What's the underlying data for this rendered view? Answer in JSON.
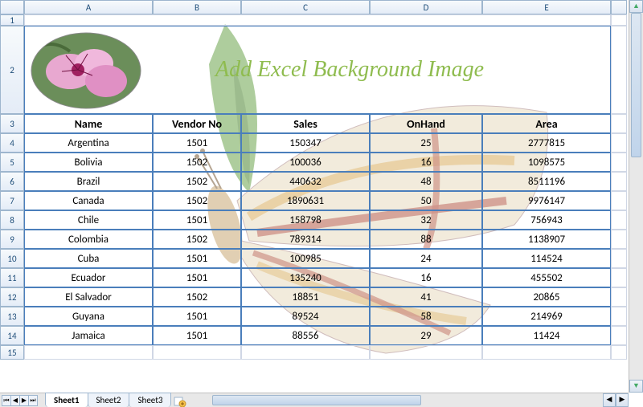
{
  "columns": [
    "A",
    "B",
    "C",
    "D",
    "E"
  ],
  "row_numbers": [
    1,
    2,
    3,
    4,
    5,
    6,
    7,
    8,
    9,
    10,
    11,
    12,
    13,
    14,
    15
  ],
  "title": "Add  Excel  Background  Image",
  "headers": [
    "Name",
    "Vendor No",
    "Sales",
    "OnHand",
    "Area"
  ],
  "rows": [
    {
      "name": "Argentina",
      "vendor": "1501",
      "sales": "150347",
      "onhand": "25",
      "area": "2777815"
    },
    {
      "name": "Bolivia",
      "vendor": "1502",
      "sales": "100036",
      "onhand": "16",
      "area": "1098575"
    },
    {
      "name": "Brazil",
      "vendor": "1502",
      "sales": "440632",
      "onhand": "48",
      "area": "8511196"
    },
    {
      "name": "Canada",
      "vendor": "1502",
      "sales": "1890631",
      "onhand": "50",
      "area": "9976147"
    },
    {
      "name": "Chile",
      "vendor": "1501",
      "sales": "158798",
      "onhand": "32",
      "area": "756943"
    },
    {
      "name": "Colombia",
      "vendor": "1502",
      "sales": "789314",
      "onhand": "88",
      "area": "1138907"
    },
    {
      "name": "Cuba",
      "vendor": "1501",
      "sales": "100985",
      "onhand": "24",
      "area": "114524"
    },
    {
      "name": "Ecuador",
      "vendor": "1501",
      "sales": "135240",
      "onhand": "16",
      "area": "455502"
    },
    {
      "name": "El Salvador",
      "vendor": "1502",
      "sales": "18851",
      "onhand": "41",
      "area": "20865"
    },
    {
      "name": "Guyana",
      "vendor": "1501",
      "sales": "89524",
      "onhand": "58",
      "area": "214969"
    },
    {
      "name": "Jamaica",
      "vendor": "1501",
      "sales": "88556",
      "onhand": "29",
      "area": "11424"
    }
  ],
  "tabs": {
    "active": "Sheet1",
    "others": [
      "Sheet2",
      "Sheet3"
    ]
  }
}
